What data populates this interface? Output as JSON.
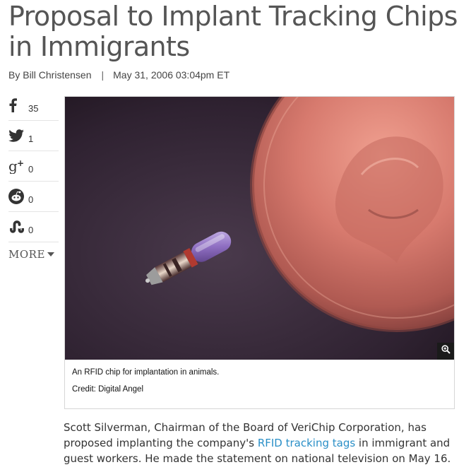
{
  "article": {
    "title": "Proposal to Implant Tracking Chips in Immigrants",
    "byline": {
      "author": "By Bill Christensen",
      "separator": "|",
      "date": "May 31, 2006 03:04pm ET"
    }
  },
  "share": {
    "items": [
      {
        "network": "facebook",
        "icon": "facebook-icon",
        "count": "35"
      },
      {
        "network": "twitter",
        "icon": "twitter-icon",
        "count": "1"
      },
      {
        "network": "google-plus",
        "icon": "google-plus-icon",
        "count": "0"
      },
      {
        "network": "reddit",
        "icon": "reddit-icon",
        "count": "0"
      },
      {
        "network": "stumbleupon",
        "icon": "stumbleupon-icon",
        "count": "0"
      }
    ],
    "more_label": "MORE"
  },
  "figure": {
    "caption": "An RFID chip for implantation in animals.",
    "credit": "Credit: Digital Angel",
    "zoom_icon": "zoom-in-icon"
  },
  "body": {
    "text_before": "Scott Silverman, Chairman of the Board of VeriChip Corporation, has proposed implanting the company's ",
    "link_text": "RFID tracking tags",
    "text_after": " in immigrant and guest workers. He made the statement on national television on May 16."
  },
  "colors": {
    "link": "#2a8fc7",
    "title": "#555555",
    "text": "#333333"
  }
}
